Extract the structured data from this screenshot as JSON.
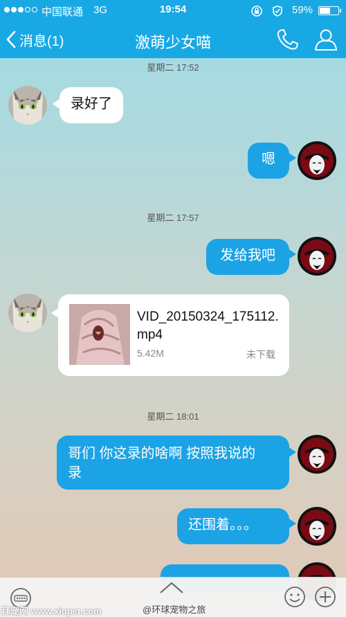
{
  "status_bar": {
    "carrier": "中国联通",
    "network": "3G",
    "time": "19:54",
    "battery": "59%",
    "battery_level": 0.59,
    "icons": [
      "signal-dots",
      "lock-rotation-icon",
      "location-icon",
      "battery-icon"
    ]
  },
  "nav": {
    "back_label": "消息(1)",
    "title": "激萌少女喵",
    "icons": [
      "chevron-left-icon",
      "phone-icon",
      "profile-icon"
    ]
  },
  "chat": {
    "timestamps": [
      "星期二 17:52",
      "星期二 17:57",
      "星期二 18:01"
    ],
    "msg1": "录好了",
    "msg2": "嗯",
    "msg3": "发给我吧",
    "file": {
      "name": "VID_20150324_175112.mp4",
      "size": "5.42M",
      "status": "未下载"
    },
    "msg5_line1": "哥们 你这录的啥啊 按照我说的",
    "msg5_line2": "录",
    "msg6": "还围着。。。"
  },
  "bottom_bar": {
    "icons": [
      "voice-icon",
      "chevron-up-icon",
      "emoji-icon",
      "plus-icon"
    ]
  },
  "watermark": {
    "left": "拜宠网 www.xiupet.com",
    "middle": "@环球宠物之旅"
  },
  "colors": {
    "header": "#18a9e4",
    "bubble_out": "#1ba3e6",
    "bubble_in": "#ffffff"
  }
}
